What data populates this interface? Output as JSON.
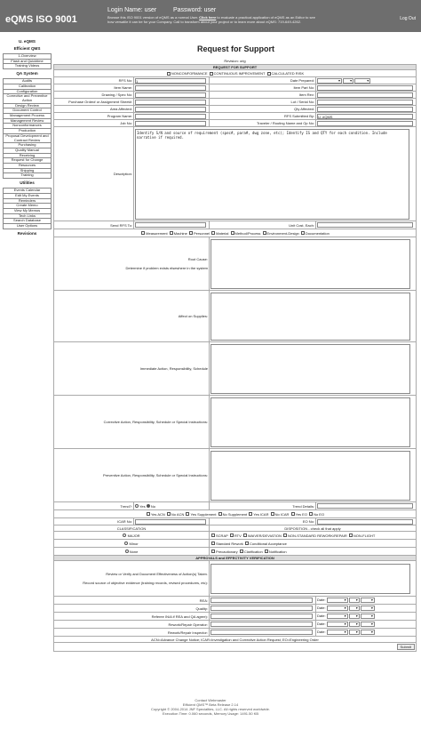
{
  "header": {
    "app_title": "eQMS ISO 9001",
    "login_name": "Login Name: user",
    "password": "Password: user",
    "blurb_before": "Browse this ISO 9001 version of eQMS as a normal User.",
    "blurb_link": "Click here",
    "blurb_after": "to evaluate a practical application of eQMS as an Editor to see how versatile it can be for your Company. Call to transform about your project or to learn more about eQMS: 719-649-4262.",
    "logout": "Log Out"
  },
  "sidebar": {
    "title": "U. eQMS",
    "groups": [
      {
        "heading": "Efficient QMS",
        "items": [
          "1-Overview",
          "Flash and Quicktime",
          "Training Videos"
        ]
      },
      {
        "heading": "QA System",
        "items": [
          "Audits",
          "Calibration",
          "Configuration",
          "Corrective and Preventive Action",
          "Design Review",
          "Document Control",
          "Management Process",
          "Management Review",
          "Nonconformances",
          "Production",
          "Proposal Development and Contract Review",
          "Purchasing",
          "Quality Manual",
          "Receiving",
          "Request for Change",
          "Resources",
          "Shipping",
          "Training"
        ]
      },
      {
        "heading": "Utilities",
        "items": [
          "Events Calendar",
          "Edit My Events",
          "Reminders",
          "Create Memo",
          "View My Memos",
          "Tech Links",
          "Search Database",
          "User Options"
        ]
      },
      {
        "heading": "Revisions",
        "items": []
      }
    ]
  },
  "page": {
    "title": "Request for Support",
    "revision": "Revision: orig"
  },
  "form": {
    "section_header": "REQUEST FOR SUPPORT",
    "type_options": [
      "NONCONFORMANCE",
      "CONTINUOUS IMPROVEMENT",
      "CALCULATED RISK"
    ],
    "rfs_no_label": "RFS No:",
    "rfs_no_value": "1",
    "date_prepared_label": "Date Prepared:",
    "item_name_label": "Item Name:",
    "item_part_no_label": "Item Part No:",
    "drawing_spec_label": "Drawing / Spec No:",
    "item_rev_label": "Item Rev:",
    "po_label": "Purchase Order# or Assignment Sheet#:",
    "lot_serial_label": "Lot / Serial No:",
    "area_affected_label": "Area Affected:",
    "qty_affected_label": "Qty Affected:",
    "program_name_label": "Program Name:",
    "rfs_submitted_by_label": "RFS Submitted By:",
    "rfs_submitted_by_value": "U. eQMS",
    "job_no_label": "Job No:",
    "traveler_label": "Traveler / Routing Name and Op No:",
    "description_label": "Description:",
    "description_value": "Identify S/N and source of requirement (spec#, para#, dwg zone, etc); Identify IS and QTY for each condition. Include narrative if required.",
    "send_rfs_label": "Send RFS To:",
    "unit_cost_label": "Unit Cost, Each:",
    "cause_categories": [
      "Measurement",
      "Machine",
      "Personnel",
      "Material",
      "Method/Process",
      "Environment-Design",
      "Documentation"
    ],
    "root_cause_label": "Root Cause:",
    "root_cause_sub": "Determine if problem exists elsewhere in the system",
    "affect_suppliers_label": "Affect on Supplies:",
    "immediate_action_label": "Immediate Action, Responsibility, Schedule",
    "corrective_action_label": "Corrective Action, Responsibility, Schedule or Special Instructions:",
    "preventive_action_label": "Preventive Action, Responsibility, Schedule or Special Instructions:",
    "trend_label": "Trend?:",
    "trend_yes": "Yes",
    "trend_no": "No",
    "trend_details_label": "Trend Details:",
    "notice_options": [
      "Yes ACN",
      "No ACN",
      "Yes Supplement",
      "No Supplement",
      "Yes ICAR",
      "No ICAR",
      "Yes EO",
      "No EO"
    ],
    "icar_no_label": "ICAR No:",
    "eo_no_label": "EO No:",
    "classification_label": "CLASSIFICATION",
    "disposition_label": "DISPOSITION - check all that apply",
    "class_major": "MAJOR",
    "class_minor": "Minor",
    "class_none": "None",
    "disp_row1": [
      "SCRAP",
      "RTV",
      "WAIVER/DEVIATION",
      "NON-STANDARD REWORK/REPAIR",
      "NON-FLIGHT"
    ],
    "disp_row2": [
      "Standard Rework",
      "Conditional Acceptance"
    ],
    "disp_row3": [
      "Precautionary",
      "Clarification",
      "Notification"
    ],
    "approvals_header": "APPROVALS and EFFECTIVITY VERIFICATION",
    "review_label": "Review or Verify and Document Effectiveness of Action(s) Taken.",
    "review_sub": "Record source of objective evidence (training records, revised procedures, etc):",
    "approvals": [
      "REA:",
      "Quality:",
      "Referee IN/A if REA and QA agree):",
      "Rework/Repair Operator:",
      "Rework/Repair Inspector:"
    ],
    "date_label": "Date:",
    "legend": "ACN=Advance Change Notice; ICAR=Investigation and Corrective Action Request; EO=Engineering Order",
    "submit_label": "Submit"
  },
  "footer": {
    "contact": "Contact Webmaster",
    "version": "Efficient QMS™ Beta Release 2.14",
    "copyright": "Copyright © 2004-2014 JNF Specialties, LLC. All rights reserved worldwide.",
    "exec": "Execution Time: 0.060 seconds, Memory Usage: 1491.50 KB"
  }
}
